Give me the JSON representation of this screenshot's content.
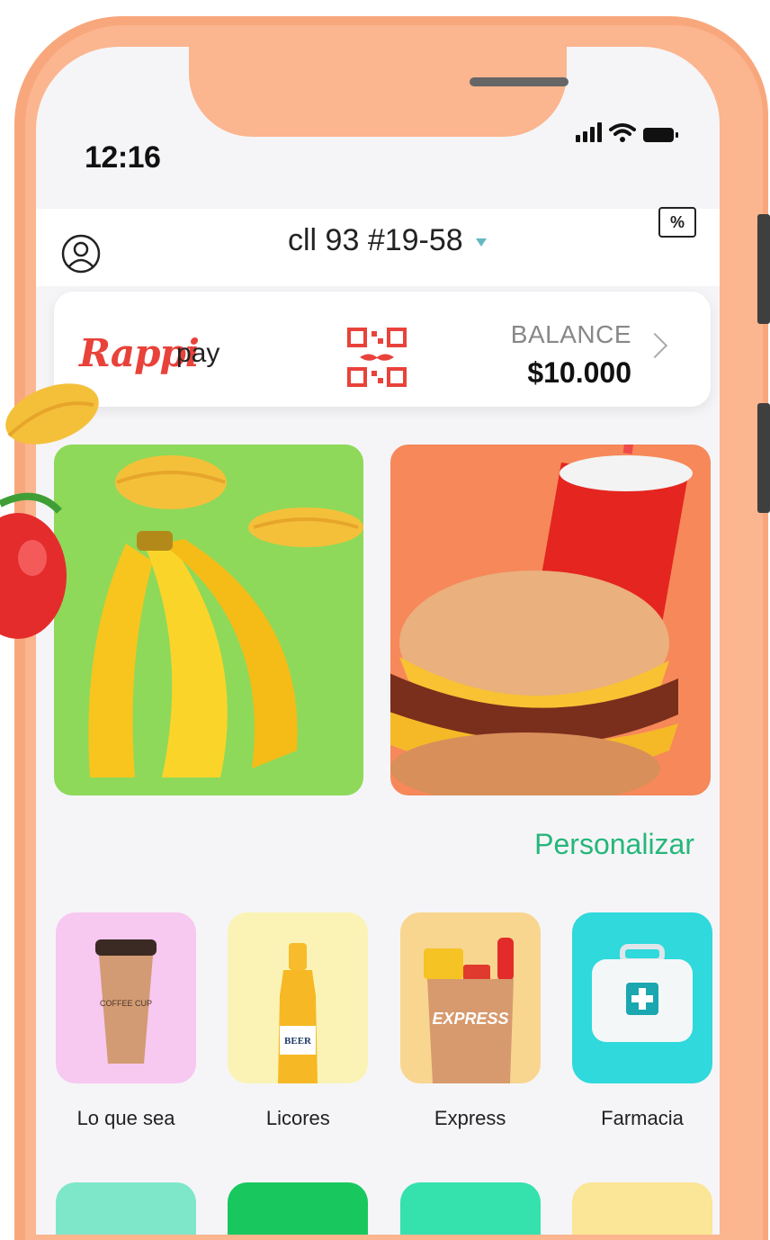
{
  "status_bar": {
    "time": "12:16"
  },
  "header": {
    "address": "cll 93 #19-58",
    "promo_icon_text": "%"
  },
  "pay_card": {
    "brand": "Rappi",
    "pay_label": "pay",
    "balance_label": "BALANCE",
    "balance_value": "$10.000"
  },
  "section": {
    "personalize_label": "Personalizar"
  },
  "categories": [
    {
      "label": "Lo que sea",
      "icon": "coffee-cup-icon",
      "color": "#f7c8f0"
    },
    {
      "label": "Licores",
      "icon": "beer-bottle-icon",
      "color": "#fbf3b5"
    },
    {
      "label": "Express",
      "icon": "grocery-bag-icon",
      "color": "#f8d68f"
    },
    {
      "label": "Farmacia",
      "icon": "first-aid-kit-icon",
      "color": "#2fd9dc"
    }
  ],
  "banner_colors": {
    "green": "#8ed959",
    "orange": "#f6885a"
  },
  "accent": "#25b77a",
  "row2_colors": [
    "#7fe7c9",
    "#18c85f",
    "#35e2ae",
    "#fbe596"
  ]
}
